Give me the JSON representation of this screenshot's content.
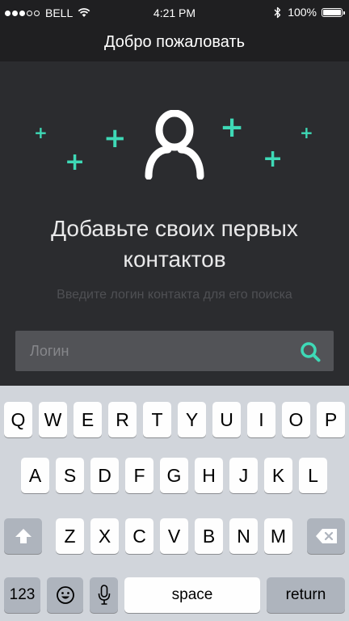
{
  "status_bar": {
    "carrier": "BELL",
    "time": "4:21 PM",
    "battery": "100%",
    "battery_level": 1.0,
    "signal_bars": 3,
    "icons": [
      "wifi-icon",
      "bluetooth-icon",
      "battery-icon"
    ]
  },
  "nav": {
    "title": "Добро пожаловать"
  },
  "main": {
    "headline_line1": "Добавьте своих первых",
    "headline_line2": "контактов",
    "subtitle": "Введите логин контакта для его поиска",
    "illustration_icons": [
      "user-icon",
      "plus-icon"
    ]
  },
  "search": {
    "placeholder": "Логин",
    "value": "",
    "icon": "search-icon"
  },
  "colors": {
    "accent": "#3ed9b6",
    "background": "#2b2c2f",
    "navbar": "#1f1f21",
    "search_field": "#525357",
    "keyboard": "#d1d5db"
  },
  "keyboard": {
    "row1": [
      "Q",
      "W",
      "E",
      "R",
      "T",
      "Y",
      "U",
      "I",
      "O",
      "P"
    ],
    "row2": [
      "A",
      "S",
      "D",
      "F",
      "G",
      "H",
      "J",
      "K",
      "L"
    ],
    "row3": [
      "Z",
      "X",
      "C",
      "V",
      "B",
      "N",
      "M"
    ],
    "numbers_label": "123",
    "space_label": "space",
    "return_label": "return",
    "icons": [
      "shift-icon",
      "delete-icon",
      "emoji-icon",
      "microphone-icon"
    ]
  }
}
